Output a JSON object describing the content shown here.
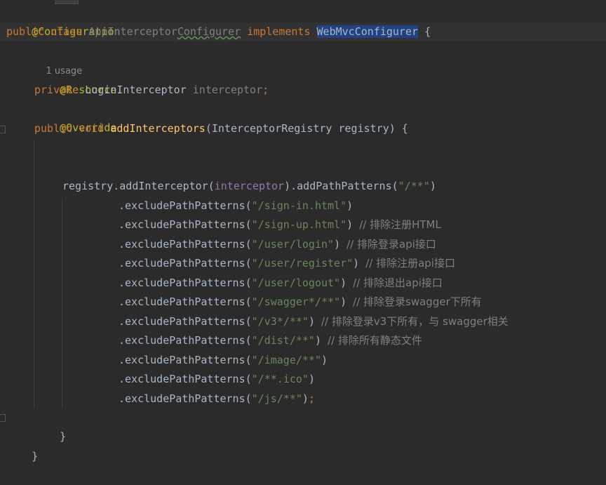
{
  "code": {
    "annotation_config": "@Configuration",
    "class_decl": {
      "kw_public": "public",
      "kw_class": "class",
      "name_part1": "AppInterceptor",
      "name_part2": "Configurer",
      "kw_implements": "implements",
      "interface": "WebMvcConfigurer",
      "brace": "{"
    },
    "usage_hint": "1 usage",
    "annotation_resource": "@Resource",
    "field_decl": {
      "kw_private": "private",
      "type": "LoginInterceptor",
      "name": "interceptor",
      "semi": ";"
    },
    "annotation_override": "@Override",
    "method_decl": {
      "kw_public": "public",
      "kw_void": "void",
      "name": "addInterceptors",
      "params": "(InterceptorRegistry registry) {"
    },
    "registry_line": {
      "prefix": "registry.addInterceptor(",
      "arg": "interceptor",
      "middle": ").addPathPatterns(",
      "pattern": "\"/**\"",
      "suffix": ")"
    },
    "exclusions": [
      {
        "method": ".excludePathPatterns(",
        "pattern": "\"/sign-in.html\"",
        "close": ")",
        "comment": ""
      },
      {
        "method": ".excludePathPatterns(",
        "pattern": "\"/sign-up.html\"",
        "close": ")",
        "comment": "// 排除注册HTML"
      },
      {
        "method": ".excludePathPatterns(",
        "pattern": "\"/user/login\"",
        "close": ")",
        "comment": "// 排除登录api接口"
      },
      {
        "method": ".excludePathPatterns(",
        "pattern": "\"/user/register\"",
        "close": ")",
        "comment": "// 排除注册api接口"
      },
      {
        "method": ".excludePathPatterns(",
        "pattern": "\"/user/logout\"",
        "close": ")",
        "comment": "// 排除退出api接口"
      },
      {
        "method": ".excludePathPatterns(",
        "pattern": "\"/swagger*/**\"",
        "close": ")",
        "comment": "// 排除登录swagger下所有"
      },
      {
        "method": ".excludePathPatterns(",
        "pattern": "\"/v3*/**\"",
        "close": ")",
        "comment": "// 排除登录v3下所有，与 swagger相关"
      },
      {
        "method": ".excludePathPatterns(",
        "pattern": "\"/dist/**\"",
        "close": ")",
        "comment": "// 排除所有静态文件"
      },
      {
        "method": ".excludePathPatterns(",
        "pattern": "\"/image/**\"",
        "close": ")",
        "comment": ""
      },
      {
        "method": ".excludePathPatterns(",
        "pattern": "\"/**.ico\"",
        "close": ")",
        "comment": ""
      },
      {
        "method": ".excludePathPatterns(",
        "pattern": "\"/js/**\"",
        "close": ")",
        "comment": "",
        "semi": ";"
      }
    ],
    "method_close": "}",
    "class_close": "}"
  },
  "colors": {
    "background": "#2b2b2b",
    "keyword": "#cc7832",
    "annotation": "#bbb529",
    "string": "#6a8759",
    "method": "#ffc66d",
    "field": "#9876aa",
    "comment": "#808080",
    "selection": "#214283"
  }
}
